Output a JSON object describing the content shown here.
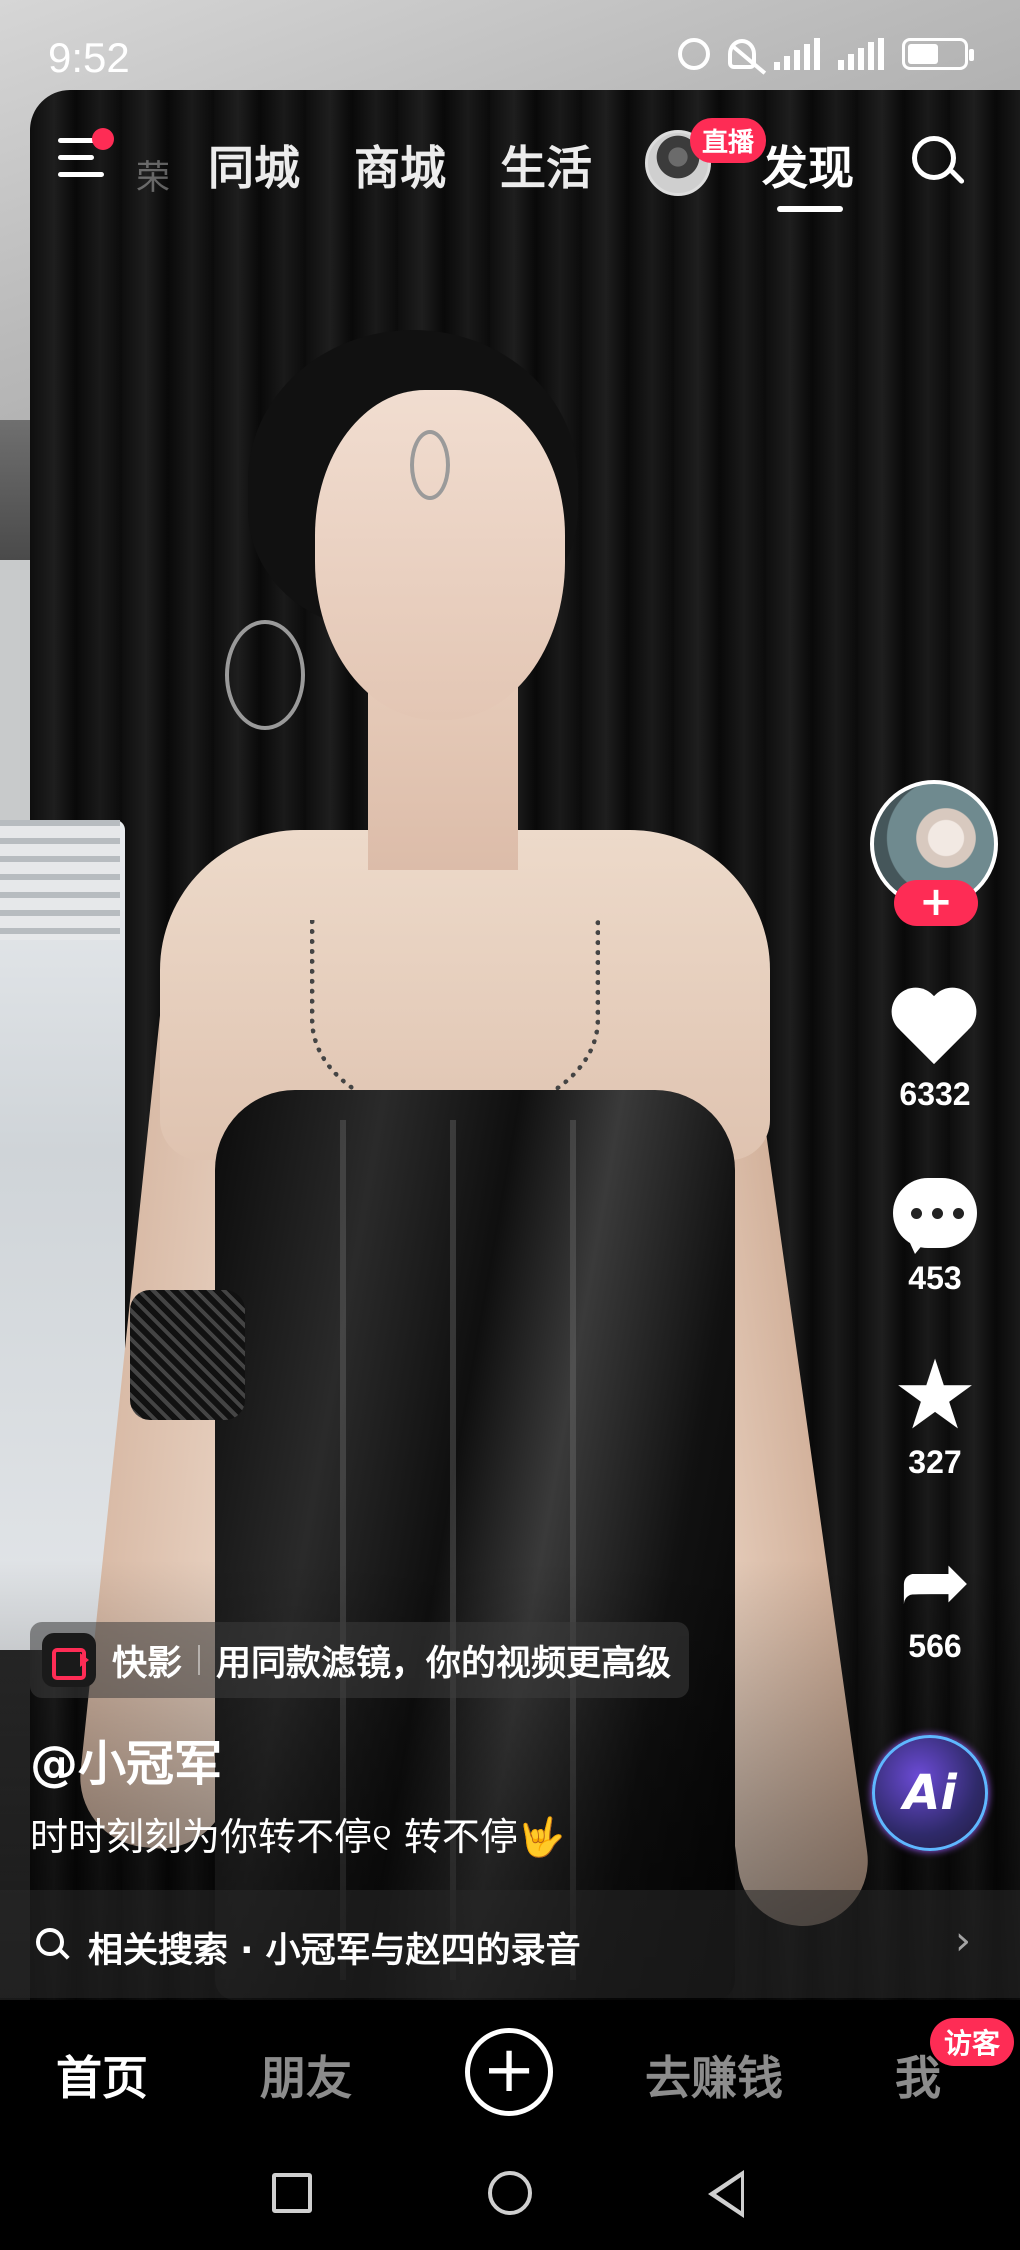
{
  "status_bar": {
    "time": "9:52"
  },
  "top_nav": {
    "ghost_tab": "荣",
    "tabs": [
      {
        "label": "同城"
      },
      {
        "label": "商城"
      },
      {
        "label": "生活"
      },
      {
        "label": "发现",
        "active": true
      }
    ],
    "live_badge": "直播"
  },
  "right_rail": {
    "follow_label": "+",
    "likes": "6332",
    "comments": "453",
    "favorites": "327",
    "shares": "566",
    "ai_label": "Ai",
    "icons": [
      "heart-icon",
      "comment-icon",
      "star-icon",
      "share-icon"
    ]
  },
  "kuaiying_banner": {
    "app_name": "快影",
    "text": "用同款滤镜，你的视频更高级"
  },
  "post": {
    "author": "@小冠军",
    "caption": "时时刻刻为你转不停୧ 转不停🤟"
  },
  "related_search": {
    "text": "相关搜索 · 小冠军与赵四的录音"
  },
  "bottom_tabs": {
    "home": "首页",
    "friends": "朋友",
    "create": "+",
    "earn": "去赚钱",
    "me": "我",
    "visitor_badge": "访客"
  },
  "colors": {
    "accent": "#fe2c55",
    "background": "#000000",
    "text": "#ffffff"
  }
}
